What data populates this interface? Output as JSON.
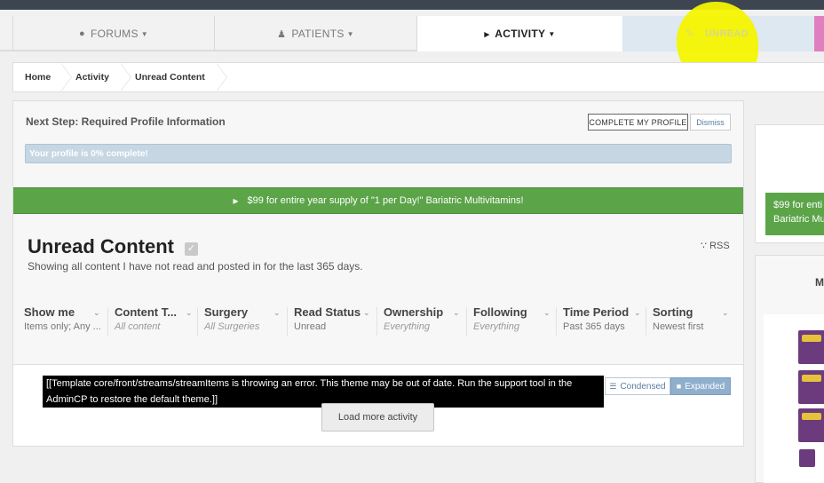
{
  "nav": {
    "items": [
      {
        "label": "FORUMS",
        "icon": "comments-icon"
      },
      {
        "label": "PATIENTS",
        "icon": "user-icon"
      },
      {
        "label": "ACTIVITY",
        "icon": "megaphone-icon"
      },
      {
        "label": "UNREAD",
        "icon": "unread-icon"
      }
    ]
  },
  "breadcrumb": [
    "Home",
    "Activity",
    "Unread Content"
  ],
  "profile_step": {
    "title": "Next Step: Required Profile Information",
    "complete_button": "COMPLETE MY PROFILE",
    "dismiss_button": "Dismiss",
    "progress_text": "Your profile is 0% complete!",
    "progress_percent": 0
  },
  "promo": {
    "text": "$99 for entire year supply of \"1 per Day!\" Bariatric Multivitamins!"
  },
  "page": {
    "title": "Unread Content",
    "subtitle": "Showing all content I have not read and posted in for the last 365 days.",
    "rss": "RSS"
  },
  "filters": [
    {
      "label": "Show me",
      "value": "Items only; Any ..."
    },
    {
      "label": "Content T...",
      "value": "All content"
    },
    {
      "label": "Surgery",
      "value": "All Surgeries"
    },
    {
      "label": "Read Status",
      "value": "Unread"
    },
    {
      "label": "Ownership",
      "value": "Everything"
    },
    {
      "label": "Following",
      "value": "Everything"
    },
    {
      "label": "Time Period",
      "value": "Past 365 days"
    },
    {
      "label": "Sorting",
      "value": "Newest first"
    }
  ],
  "stream": {
    "error_text": "[[Template core/front/streams/streamItems is throwing an error. This theme may be out of date. Run the support tool in the AdminCP to restore the default theme.]]",
    "condensed_label": "Condensed",
    "expanded_label": "Expanded",
    "load_more": "Load more activity"
  },
  "sidebar": {
    "ad_text_line1": "$99 for enti",
    "ad_text_line2": "Bariatric Mu",
    "widget_heading": "M"
  },
  "colors": {
    "promo_green": "#5ba448",
    "accent_blue": "#8fafcd",
    "topbar": "#3d4650",
    "highlight_yellow": "#f4f400"
  }
}
